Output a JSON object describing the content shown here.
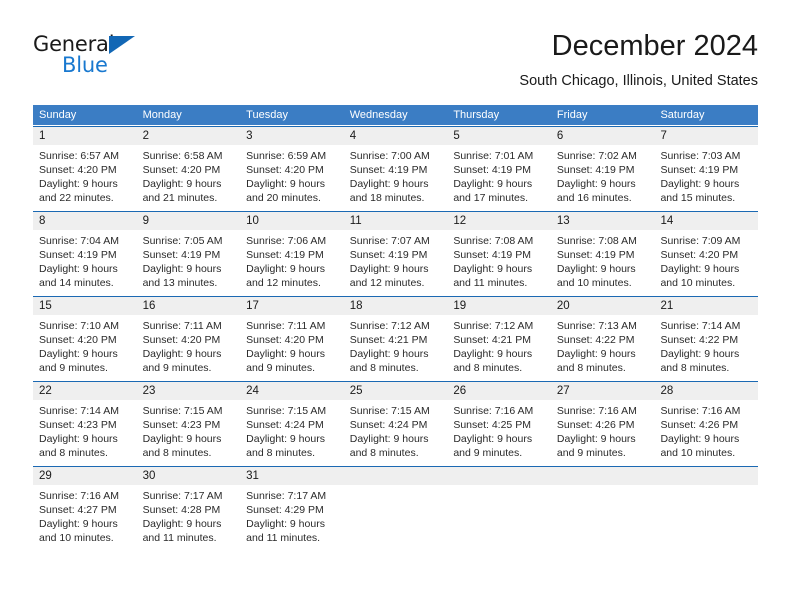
{
  "logo": {
    "word_one": "General",
    "word_two": "Blue",
    "triangle_color": "#1267b5",
    "blue_color": "#1878cf"
  },
  "header": {
    "title": "December 2024",
    "subtitle": "South Chicago, Illinois, United States"
  },
  "theme": {
    "header_bar_color": "#3b7dc4",
    "week_rule_color": "#1b69b3",
    "day_band_color": "#efefef"
  },
  "weekday_headers": [
    "Sunday",
    "Monday",
    "Tuesday",
    "Wednesday",
    "Thursday",
    "Friday",
    "Saturday"
  ],
  "weeks": [
    [
      {
        "day": "1",
        "sunrise": "Sunrise: 6:57 AM",
        "sunset": "Sunset: 4:20 PM",
        "daylight1": "Daylight: 9 hours",
        "daylight2": "and 22 minutes."
      },
      {
        "day": "2",
        "sunrise": "Sunrise: 6:58 AM",
        "sunset": "Sunset: 4:20 PM",
        "daylight1": "Daylight: 9 hours",
        "daylight2": "and 21 minutes."
      },
      {
        "day": "3",
        "sunrise": "Sunrise: 6:59 AM",
        "sunset": "Sunset: 4:20 PM",
        "daylight1": "Daylight: 9 hours",
        "daylight2": "and 20 minutes."
      },
      {
        "day": "4",
        "sunrise": "Sunrise: 7:00 AM",
        "sunset": "Sunset: 4:19 PM",
        "daylight1": "Daylight: 9 hours",
        "daylight2": "and 18 minutes."
      },
      {
        "day": "5",
        "sunrise": "Sunrise: 7:01 AM",
        "sunset": "Sunset: 4:19 PM",
        "daylight1": "Daylight: 9 hours",
        "daylight2": "and 17 minutes."
      },
      {
        "day": "6",
        "sunrise": "Sunrise: 7:02 AM",
        "sunset": "Sunset: 4:19 PM",
        "daylight1": "Daylight: 9 hours",
        "daylight2": "and 16 minutes."
      },
      {
        "day": "7",
        "sunrise": "Sunrise: 7:03 AM",
        "sunset": "Sunset: 4:19 PM",
        "daylight1": "Daylight: 9 hours",
        "daylight2": "and 15 minutes."
      }
    ],
    [
      {
        "day": "8",
        "sunrise": "Sunrise: 7:04 AM",
        "sunset": "Sunset: 4:19 PM",
        "daylight1": "Daylight: 9 hours",
        "daylight2": "and 14 minutes."
      },
      {
        "day": "9",
        "sunrise": "Sunrise: 7:05 AM",
        "sunset": "Sunset: 4:19 PM",
        "daylight1": "Daylight: 9 hours",
        "daylight2": "and 13 minutes."
      },
      {
        "day": "10",
        "sunrise": "Sunrise: 7:06 AM",
        "sunset": "Sunset: 4:19 PM",
        "daylight1": "Daylight: 9 hours",
        "daylight2": "and 12 minutes."
      },
      {
        "day": "11",
        "sunrise": "Sunrise: 7:07 AM",
        "sunset": "Sunset: 4:19 PM",
        "daylight1": "Daylight: 9 hours",
        "daylight2": "and 12 minutes."
      },
      {
        "day": "12",
        "sunrise": "Sunrise: 7:08 AM",
        "sunset": "Sunset: 4:19 PM",
        "daylight1": "Daylight: 9 hours",
        "daylight2": "and 11 minutes."
      },
      {
        "day": "13",
        "sunrise": "Sunrise: 7:08 AM",
        "sunset": "Sunset: 4:19 PM",
        "daylight1": "Daylight: 9 hours",
        "daylight2": "and 10 minutes."
      },
      {
        "day": "14",
        "sunrise": "Sunrise: 7:09 AM",
        "sunset": "Sunset: 4:20 PM",
        "daylight1": "Daylight: 9 hours",
        "daylight2": "and 10 minutes."
      }
    ],
    [
      {
        "day": "15",
        "sunrise": "Sunrise: 7:10 AM",
        "sunset": "Sunset: 4:20 PM",
        "daylight1": "Daylight: 9 hours",
        "daylight2": "and 9 minutes."
      },
      {
        "day": "16",
        "sunrise": "Sunrise: 7:11 AM",
        "sunset": "Sunset: 4:20 PM",
        "daylight1": "Daylight: 9 hours",
        "daylight2": "and 9 minutes."
      },
      {
        "day": "17",
        "sunrise": "Sunrise: 7:11 AM",
        "sunset": "Sunset: 4:20 PM",
        "daylight1": "Daylight: 9 hours",
        "daylight2": "and 9 minutes."
      },
      {
        "day": "18",
        "sunrise": "Sunrise: 7:12 AM",
        "sunset": "Sunset: 4:21 PM",
        "daylight1": "Daylight: 9 hours",
        "daylight2": "and 8 minutes."
      },
      {
        "day": "19",
        "sunrise": "Sunrise: 7:12 AM",
        "sunset": "Sunset: 4:21 PM",
        "daylight1": "Daylight: 9 hours",
        "daylight2": "and 8 minutes."
      },
      {
        "day": "20",
        "sunrise": "Sunrise: 7:13 AM",
        "sunset": "Sunset: 4:22 PM",
        "daylight1": "Daylight: 9 hours",
        "daylight2": "and 8 minutes."
      },
      {
        "day": "21",
        "sunrise": "Sunrise: 7:14 AM",
        "sunset": "Sunset: 4:22 PM",
        "daylight1": "Daylight: 9 hours",
        "daylight2": "and 8 minutes."
      }
    ],
    [
      {
        "day": "22",
        "sunrise": "Sunrise: 7:14 AM",
        "sunset": "Sunset: 4:23 PM",
        "daylight1": "Daylight: 9 hours",
        "daylight2": "and 8 minutes."
      },
      {
        "day": "23",
        "sunrise": "Sunrise: 7:15 AM",
        "sunset": "Sunset: 4:23 PM",
        "daylight1": "Daylight: 9 hours",
        "daylight2": "and 8 minutes."
      },
      {
        "day": "24",
        "sunrise": "Sunrise: 7:15 AM",
        "sunset": "Sunset: 4:24 PM",
        "daylight1": "Daylight: 9 hours",
        "daylight2": "and 8 minutes."
      },
      {
        "day": "25",
        "sunrise": "Sunrise: 7:15 AM",
        "sunset": "Sunset: 4:24 PM",
        "daylight1": "Daylight: 9 hours",
        "daylight2": "and 8 minutes."
      },
      {
        "day": "26",
        "sunrise": "Sunrise: 7:16 AM",
        "sunset": "Sunset: 4:25 PM",
        "daylight1": "Daylight: 9 hours",
        "daylight2": "and 9 minutes."
      },
      {
        "day": "27",
        "sunrise": "Sunrise: 7:16 AM",
        "sunset": "Sunset: 4:26 PM",
        "daylight1": "Daylight: 9 hours",
        "daylight2": "and 9 minutes."
      },
      {
        "day": "28",
        "sunrise": "Sunrise: 7:16 AM",
        "sunset": "Sunset: 4:26 PM",
        "daylight1": "Daylight: 9 hours",
        "daylight2": "and 10 minutes."
      }
    ],
    [
      {
        "day": "29",
        "sunrise": "Sunrise: 7:16 AM",
        "sunset": "Sunset: 4:27 PM",
        "daylight1": "Daylight: 9 hours",
        "daylight2": "and 10 minutes."
      },
      {
        "day": "30",
        "sunrise": "Sunrise: 7:17 AM",
        "sunset": "Sunset: 4:28 PM",
        "daylight1": "Daylight: 9 hours",
        "daylight2": "and 11 minutes."
      },
      {
        "day": "31",
        "sunrise": "Sunrise: 7:17 AM",
        "sunset": "Sunset: 4:29 PM",
        "daylight1": "Daylight: 9 hours",
        "daylight2": "and 11 minutes."
      },
      {
        "day": "",
        "sunrise": "",
        "sunset": "",
        "daylight1": "",
        "daylight2": ""
      },
      {
        "day": "",
        "sunrise": "",
        "sunset": "",
        "daylight1": "",
        "daylight2": ""
      },
      {
        "day": "",
        "sunrise": "",
        "sunset": "",
        "daylight1": "",
        "daylight2": ""
      },
      {
        "day": "",
        "sunrise": "",
        "sunset": "",
        "daylight1": "",
        "daylight2": ""
      }
    ]
  ]
}
